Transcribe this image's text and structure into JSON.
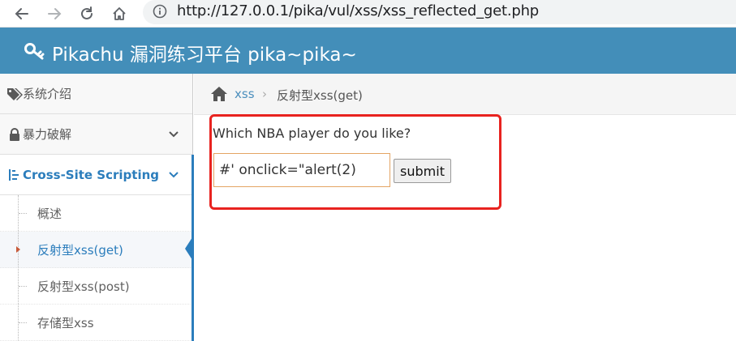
{
  "browser": {
    "url": "http://127.0.0.1/pika/vul/xss/xss_reflected_get.php",
    "icons": [
      "back-icon",
      "forward-icon",
      "reload-icon",
      "home-icon",
      "info-icon"
    ]
  },
  "header": {
    "title": "Pikachu 漏洞练习平台 pika~pika~",
    "logo_icon": "key-icon",
    "background": "#438eb9"
  },
  "sidebar": {
    "items": [
      {
        "label": "系统介绍",
        "icon": "tags-icon"
      },
      {
        "label": "暴力破解",
        "icon": "lock-icon"
      },
      {
        "label": "Cross-Site Scripting",
        "icon": "list-icon",
        "active": true
      }
    ],
    "sub_items": [
      {
        "label": "概述"
      },
      {
        "label": "反射型xss(get)",
        "selected": true
      },
      {
        "label": "反射型xss(post)"
      },
      {
        "label": "存储型xss"
      }
    ]
  },
  "breadcrumb": {
    "link": "xss",
    "separator": "›",
    "current": "反射型xss(get)"
  },
  "main": {
    "question": "Which NBA player do you like?",
    "input_value": "#' onclick=\"alert(2)",
    "submit_label": "submit"
  },
  "colors": {
    "accent": "#2b7dbc",
    "highlight": "#e8231f",
    "input_border": "#e4a464"
  }
}
